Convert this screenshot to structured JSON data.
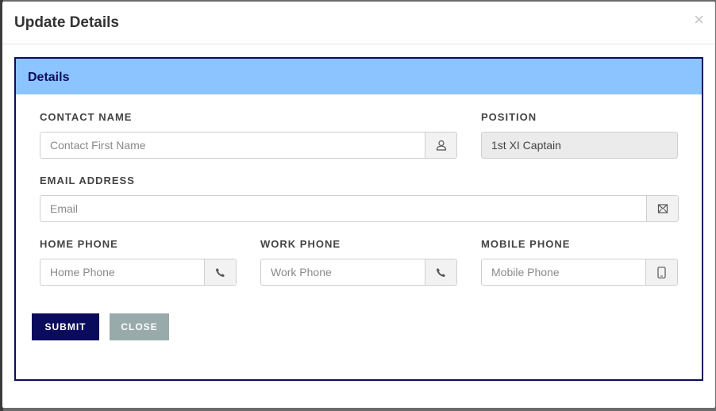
{
  "modal": {
    "title": "Update Details",
    "close_symbol": "×"
  },
  "panel": {
    "title": "Details"
  },
  "fields": {
    "contact_name": {
      "label": "CONTACT NAME",
      "placeholder": "Contact First Name",
      "icon": "user-icon"
    },
    "position": {
      "label": "POSITION",
      "value": "1st XI Captain"
    },
    "email": {
      "label": "EMAIL ADDRESS",
      "placeholder": "Email",
      "icon": "envelope-icon"
    },
    "home_phone": {
      "label": "HOME PHONE",
      "placeholder": "Home Phone",
      "icon": "phone-icon"
    },
    "work_phone": {
      "label": "WORK PHONE",
      "placeholder": "Work Phone",
      "icon": "phone-icon"
    },
    "mobile_phone": {
      "label": "MOBILE PHONE",
      "placeholder": "Mobile Phone",
      "icon": "mobile-icon"
    }
  },
  "buttons": {
    "submit": "SUBMIT",
    "close": "CLOSE"
  },
  "colors": {
    "accent": "#0b0b5e",
    "panel_heading": "#8cc4ff",
    "close_button": "#98aaaa"
  }
}
